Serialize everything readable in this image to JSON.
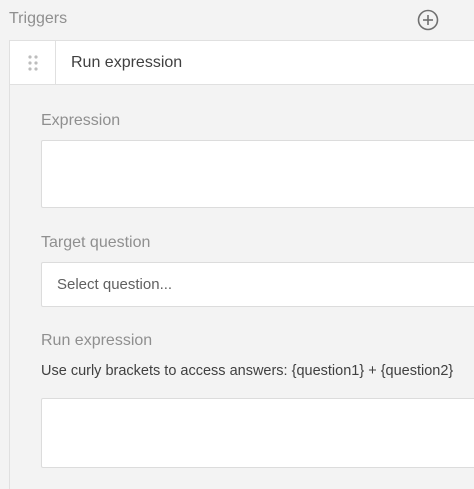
{
  "section": {
    "title": "Triggers"
  },
  "trigger": {
    "name": "Run expression",
    "expression": {
      "label": "Expression",
      "value": ""
    },
    "target_question": {
      "label": "Target question",
      "placeholder": "Select question..."
    },
    "run_expression": {
      "label": "Run expression",
      "hint": "Use curly brackets to access answers: {question1} + {question2}",
      "value": ""
    }
  },
  "colors": {
    "background": "#f3f3f3",
    "label": "#8f8f8f",
    "text": "#404040",
    "border": "#e0e0e0"
  }
}
